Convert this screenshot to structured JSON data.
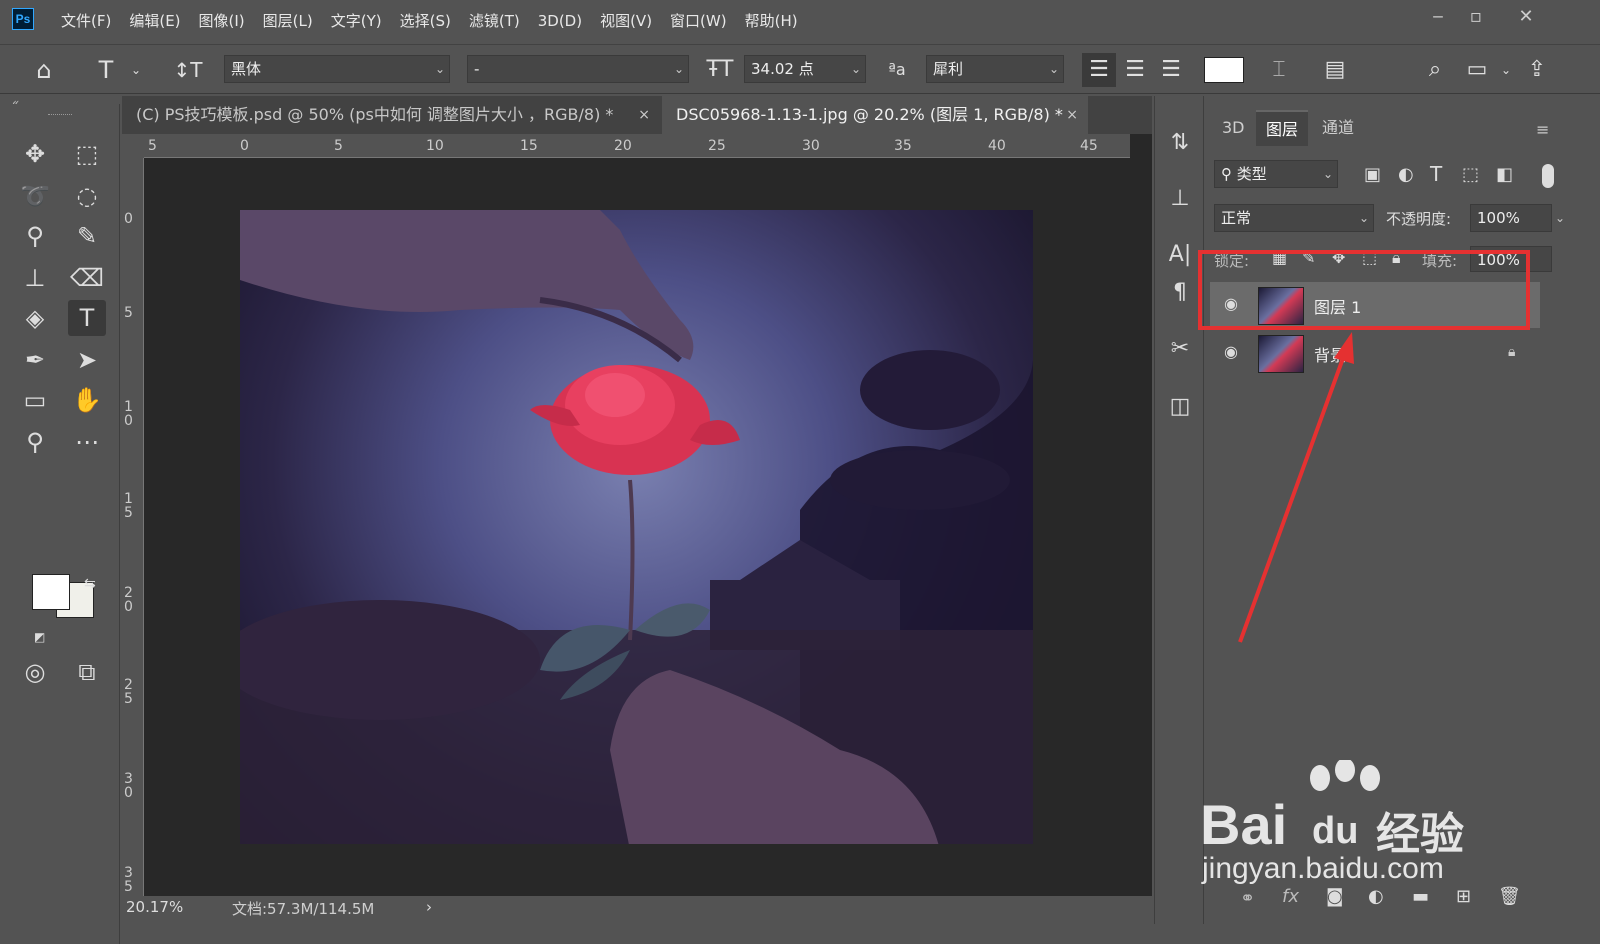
{
  "app": {
    "logo_text": "Ps"
  },
  "menu": [
    "文件(F)",
    "编辑(E)",
    "图像(I)",
    "图层(L)",
    "文字(Y)",
    "选择(S)",
    "滤镜(T)",
    "3D(D)",
    "视图(V)",
    "窗口(W)",
    "帮助(H)"
  ],
  "options": {
    "font_family": "黑体",
    "font_style": "-",
    "font_size": "34.02 点",
    "antialias": "犀利"
  },
  "tabs": [
    {
      "label": "(C) PS技巧模板.psd @ 50% (ps中如何 调整图片大小 ，RGB/8) *",
      "close": "×"
    },
    {
      "label": "DSC05968-1.13-1.jpg @ 20.2% (图层 1, RGB/8) *",
      "close": "×"
    }
  ],
  "ruler_h": [
    "5",
    "0",
    "5",
    "10",
    "15",
    "20",
    "25",
    "30",
    "35",
    "40",
    "45"
  ],
  "ruler_v": [
    "0",
    "5",
    "1 0",
    "1 5",
    "2 0",
    "2 5",
    "3 0",
    "3 5"
  ],
  "status": {
    "zoom": "20.17%",
    "doc": "文档:57.3M/114.5M",
    "arrow": "›"
  },
  "panel": {
    "tabs": [
      "3D",
      "图层",
      "通道"
    ],
    "filter_label": "类型",
    "blend_mode": "正常",
    "opacity_label": "不透明度:",
    "opacity_value": "100%",
    "lock_label": "锁定:",
    "fill_label": "填充:",
    "fill_value": "100%",
    "layers": [
      {
        "name": "图层 1",
        "selected": true
      },
      {
        "name": "背景",
        "locked": true
      }
    ]
  },
  "watermark": {
    "brand": "Bai",
    "brand2": "du",
    "cn": "经验",
    "url": "jingyan.baidu.com"
  },
  "colors": {
    "highlight": "#e53131",
    "selection": "#6b6b6b"
  }
}
